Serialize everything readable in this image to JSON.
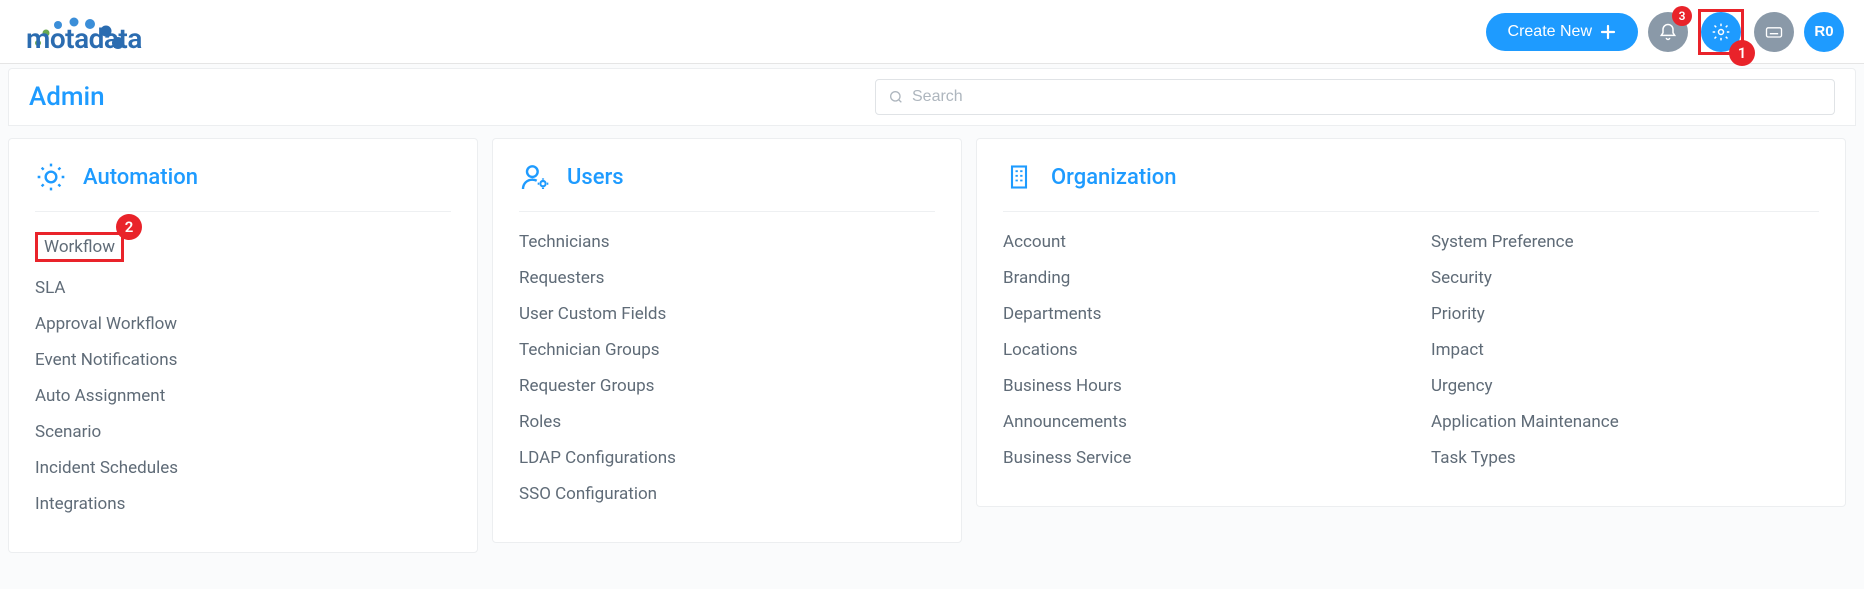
{
  "header": {
    "logo_text": "motadata",
    "create_label": "Create New",
    "notif_count": "3",
    "avatar_text": "R0",
    "annotation_1": "1"
  },
  "subbar": {
    "page_title": "Admin",
    "search_placeholder": "Search"
  },
  "cards": {
    "automation": {
      "title": "Automation",
      "annotation_2": "2",
      "items": [
        "Workflow",
        "SLA",
        "Approval Workflow",
        "Event Notifications",
        "Auto Assignment",
        "Scenario",
        "Incident Schedules",
        "Integrations"
      ]
    },
    "users": {
      "title": "Users",
      "items": [
        "Technicians",
        "Requesters",
        "User Custom Fields",
        "Technician Groups",
        "Requester Groups",
        "Roles",
        "LDAP Configurations",
        "SSO Configuration"
      ]
    },
    "organization": {
      "title": "Organization",
      "col1": [
        "Account",
        "Branding",
        "Departments",
        "Locations",
        "Business Hours",
        "Announcements",
        "Business Service"
      ],
      "col2": [
        "System Preference",
        "Security",
        "Priority",
        "Impact",
        "Urgency",
        "Application Maintenance",
        "Task Types"
      ]
    }
  }
}
